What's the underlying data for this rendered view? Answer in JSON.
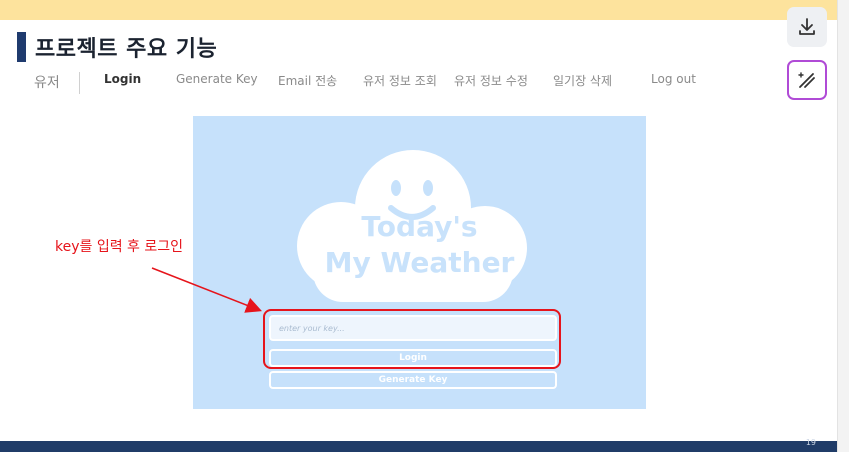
{
  "slide": {
    "title": "프로젝트 주요 기능",
    "nav": [
      "유저",
      "Login",
      "Generate Key",
      "Email 전송",
      "유저 정보 조회",
      "유저 정보 수정",
      "일기장 삭제",
      "Log out"
    ],
    "page_number": "19"
  },
  "app": {
    "brand_line1": "Today's",
    "brand_line2": "My Weather",
    "input_placeholder": "enter your key...",
    "login_label": "Login",
    "generate_key_label": "Generate Key"
  },
  "annotation": {
    "text": "key를 입력 후 로그인",
    "color": "#e6141b"
  },
  "toolbar": {
    "download_icon": "download-icon",
    "magic_icon": "magic-wand-icon"
  },
  "colors": {
    "accent": "#1f3b6e",
    "top_band": "#fde39d",
    "card_bg": "#c6e1fb"
  }
}
